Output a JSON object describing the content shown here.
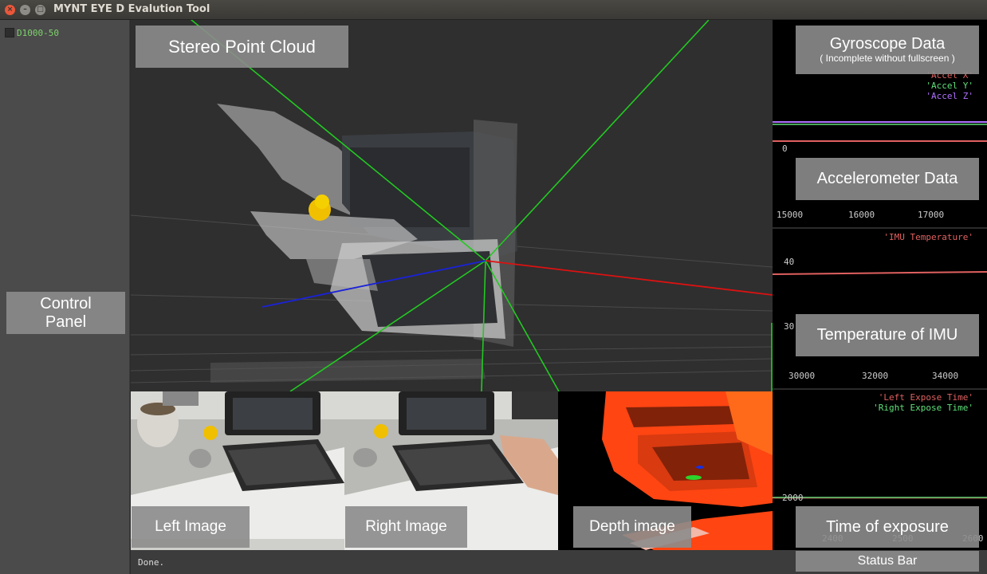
{
  "window": {
    "title": "MYNT EYE D Evalution Tool"
  },
  "sidebar": {
    "device": "D1000-50"
  },
  "labels": {
    "control_panel": "Control\nPanel",
    "stereo_point_cloud": "Stereo Point Cloud",
    "gyroscope_data": "Gyroscope Data",
    "gyroscope_note": "( Incomplete without fullscreen )",
    "accelerometer_data": "Accelerometer Data",
    "temperature_of_imu": "Temperature of IMU",
    "time_of_exposure": "Time of exposure",
    "left_image": "Left Image",
    "right_image": "Right Image",
    "depth_image": "Depth image",
    "status_bar": "Status Bar"
  },
  "accel_plot": {
    "legend": [
      "'Accel X'",
      "'Accel Y'",
      "'Accel Z'"
    ],
    "legend_colors": [
      "#e06060",
      "#5fe07a",
      "#b070ff"
    ],
    "y_ticks": [
      "0"
    ],
    "x_ticks": [
      "15000",
      "16000",
      "17000"
    ]
  },
  "temp_plot": {
    "legend": [
      "'IMU Temperature'"
    ],
    "legend_colors": [
      "#e06060"
    ],
    "y_ticks": [
      "40",
      "30"
    ],
    "x_ticks": [
      "30000",
      "32000",
      "34000"
    ]
  },
  "exposure_plot": {
    "legend": [
      "'Left Expose Time'",
      "'Right Expose Time'"
    ],
    "legend_colors": [
      "#e06060",
      "#5fe07a"
    ],
    "y_ticks": [
      "2000"
    ],
    "x_ticks": [
      "2400",
      "2500",
      "2600"
    ]
  },
  "status": {
    "text": "Done."
  }
}
